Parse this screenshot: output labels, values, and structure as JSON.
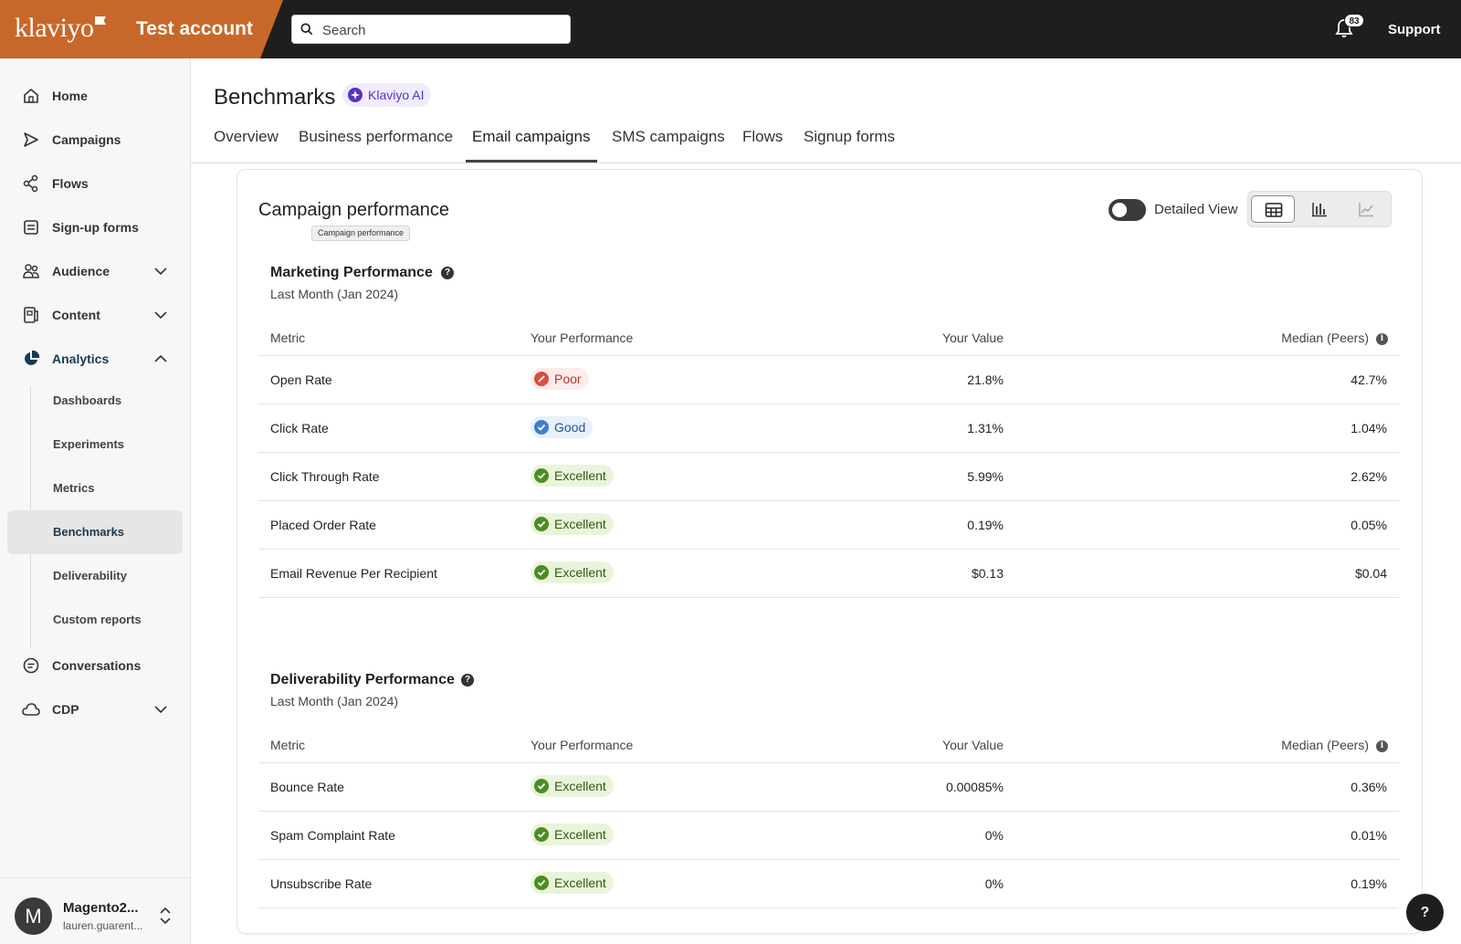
{
  "brand": {
    "logo_text": "klaviyo",
    "account_name": "Test account",
    "brand_color": "#c8672a"
  },
  "search": {
    "placeholder": "Search"
  },
  "topbar": {
    "notifications_count": "83",
    "support_label": "Support"
  },
  "sidebar": {
    "items": [
      {
        "label": "Home",
        "icon": "home-icon"
      },
      {
        "label": "Campaigns",
        "icon": "send-icon"
      },
      {
        "label": "Flows",
        "icon": "flows-icon"
      },
      {
        "label": "Sign-up forms",
        "icon": "form-icon"
      },
      {
        "label": "Audience",
        "icon": "people-icon",
        "expandable": true
      },
      {
        "label": "Content",
        "icon": "content-icon",
        "expandable": true
      },
      {
        "label": "Analytics",
        "icon": "pie-chart-icon",
        "expandable": true,
        "expanded": true
      },
      {
        "label": "Conversations",
        "icon": "chat-icon"
      },
      {
        "label": "CDP",
        "icon": "cloud-icon",
        "expandable": true
      }
    ],
    "analytics_sub": [
      "Dashboards",
      "Experiments",
      "Metrics",
      "Benchmarks",
      "Deliverability",
      "Custom reports"
    ],
    "active_sub": "Benchmarks"
  },
  "user": {
    "initial": "M",
    "name": "Magento2...",
    "email": "lauren.guarent..."
  },
  "header": {
    "title": "Benchmarks",
    "ai_badge": "Klaviyo AI",
    "tabs": [
      "Overview",
      "Business performance",
      "Email campaigns",
      "SMS campaigns",
      "Flows",
      "Signup forms"
    ],
    "active_tab": "Email campaigns"
  },
  "card": {
    "title": "Campaign performance",
    "tooltip": "Campaign performance",
    "detailed_view_label": "Detailed View",
    "detailed_view_on": false,
    "view_modes": [
      "table-view",
      "bar-chart-view",
      "line-chart-view"
    ],
    "active_view": "table-view"
  },
  "columns": {
    "metric": "Metric",
    "performance": "Your Performance",
    "value": "Your Value",
    "median": "Median (Peers)"
  },
  "marketing": {
    "title": "Marketing Performance",
    "period": "Last Month (Jan 2024)",
    "rows": [
      {
        "metric": "Open Rate",
        "rating": "Poor",
        "value": "21.8%",
        "median": "42.7%"
      },
      {
        "metric": "Click Rate",
        "rating": "Good",
        "value": "1.31%",
        "median": "1.04%"
      },
      {
        "metric": "Click Through Rate",
        "rating": "Excellent",
        "value": "5.99%",
        "median": "2.62%"
      },
      {
        "metric": "Placed Order Rate",
        "rating": "Excellent",
        "value": "0.19%",
        "median": "0.05%"
      },
      {
        "metric": "Email Revenue Per Recipient",
        "rating": "Excellent",
        "value": "$0.13",
        "median": "$0.04"
      }
    ]
  },
  "deliverability": {
    "title": "Deliverability Performance",
    "period": "Last Month (Jan 2024)",
    "rows": [
      {
        "metric": "Bounce Rate",
        "rating": "Excellent",
        "value": "0.00085%",
        "median": "0.36%"
      },
      {
        "metric": "Spam Complaint Rate",
        "rating": "Excellent",
        "value": "0%",
        "median": "0.01%"
      },
      {
        "metric": "Unsubscribe Rate",
        "rating": "Excellent",
        "value": "0%",
        "median": "0.19%"
      }
    ]
  },
  "help_fab": "?"
}
